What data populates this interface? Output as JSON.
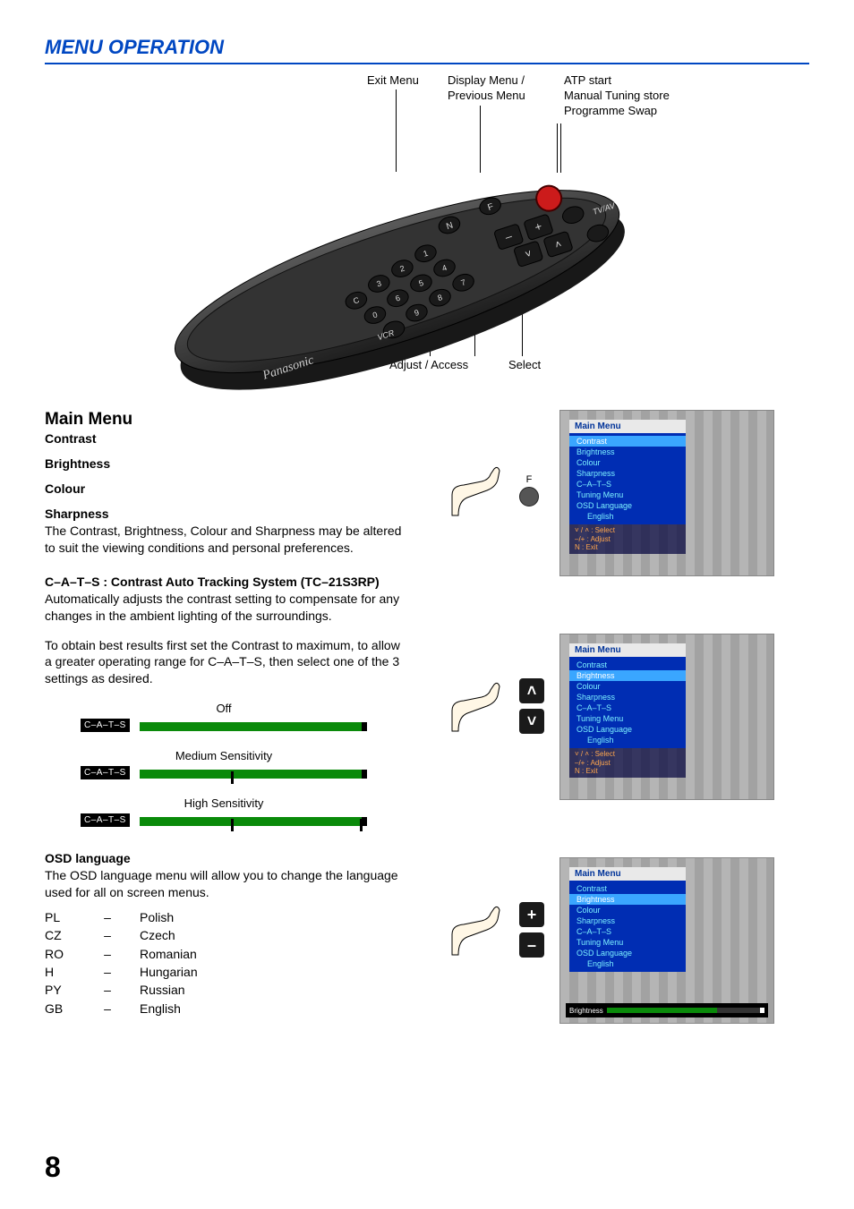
{
  "page_title": "MENU OPERATION",
  "page_number": "8",
  "remote": {
    "callouts": {
      "exit_menu": "Exit Menu",
      "display_menu": "Display Menu /\nPrevious Menu",
      "atp": "ATP start\nManual Tuning store\nProgramme Swap",
      "adjust_access": "Adjust / Access",
      "select": "Select"
    },
    "brand": "Panasonic",
    "vcr_label": "VCR",
    "tvav_label": "TV/AV",
    "buttons": [
      "1",
      "2",
      "3",
      "4",
      "5",
      "6",
      "7",
      "8",
      "9",
      "0",
      "C",
      "F",
      "N",
      "+",
      "–"
    ]
  },
  "main_menu": {
    "heading": "Main Menu",
    "items": {
      "contrast": "Contrast",
      "brightness": "Brightness",
      "colour": "Colour",
      "sharpness": "Sharpness"
    },
    "sharpness_body": "The Contrast, Brightness, Colour and Sharpness may be altered to suit the viewing conditions and personal preferences.",
    "cats_heading": "C–A–T–S :  Contrast Auto Tracking System (TC–21S3RP)",
    "cats_body_1": "Automatically adjusts the contrast setting to compensate for any changes in the ambient lighting of the surroundings.",
    "cats_body_2": "To obtain best results first set the Contrast to maximum, to allow a greater operating range for C–A–T–S, then select one of the 3 settings as desired.",
    "cats_bars": {
      "tag": "C–A–T–S",
      "off": "Off",
      "medium": "Medium Sensitivity",
      "high": "High Sensitivity"
    },
    "osd_heading": "OSD language",
    "osd_body": "The OSD language menu will allow you to change the language used for all on screen menus.",
    "languages": [
      {
        "code": "PL",
        "dash": "–",
        "name": "Polish"
      },
      {
        "code": "CZ",
        "dash": "–",
        "name": "Czech"
      },
      {
        "code": "RO",
        "dash": "–",
        "name": "Romanian"
      },
      {
        "code": "H",
        "dash": "–",
        "name": "Hungarian"
      },
      {
        "code": "PY",
        "dash": "–",
        "name": "Russian"
      },
      {
        "code": "GB",
        "dash": "–",
        "name": "English"
      }
    ]
  },
  "osd_screens": {
    "title": "Main Menu",
    "items": [
      "Contrast",
      "Brightness",
      "Colour",
      "Sharpness",
      "C–A–T–S",
      "Tuning Menu",
      "OSD Language",
      "English"
    ],
    "help": [
      "˅ / ˄  :  Select",
      "–/+  :  Adjust",
      "N   :  Exit"
    ],
    "brightness_label": "Brightness"
  },
  "hand_labels": {
    "f": "F",
    "up": "˄",
    "down": "˅",
    "plus": "+",
    "minus": "–"
  }
}
